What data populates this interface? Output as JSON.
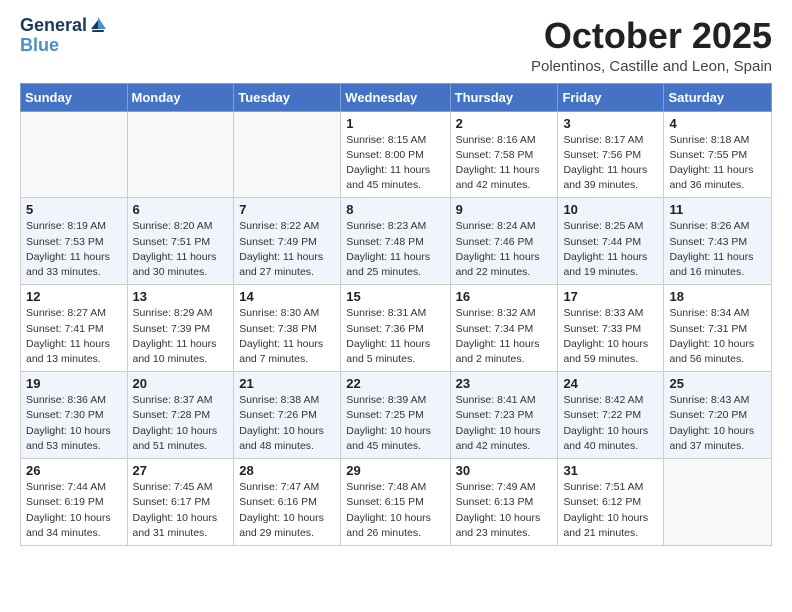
{
  "header": {
    "logo_line1": "General",
    "logo_line2": "Blue",
    "month": "October 2025",
    "location": "Polentinos, Castille and Leon, Spain"
  },
  "days_of_week": [
    "Sunday",
    "Monday",
    "Tuesday",
    "Wednesday",
    "Thursday",
    "Friday",
    "Saturday"
  ],
  "weeks": [
    [
      {
        "day": "",
        "info": ""
      },
      {
        "day": "",
        "info": ""
      },
      {
        "day": "",
        "info": ""
      },
      {
        "day": "1",
        "info": "Sunrise: 8:15 AM\nSunset: 8:00 PM\nDaylight: 11 hours and 45 minutes."
      },
      {
        "day": "2",
        "info": "Sunrise: 8:16 AM\nSunset: 7:58 PM\nDaylight: 11 hours and 42 minutes."
      },
      {
        "day": "3",
        "info": "Sunrise: 8:17 AM\nSunset: 7:56 PM\nDaylight: 11 hours and 39 minutes."
      },
      {
        "day": "4",
        "info": "Sunrise: 8:18 AM\nSunset: 7:55 PM\nDaylight: 11 hours and 36 minutes."
      }
    ],
    [
      {
        "day": "5",
        "info": "Sunrise: 8:19 AM\nSunset: 7:53 PM\nDaylight: 11 hours and 33 minutes."
      },
      {
        "day": "6",
        "info": "Sunrise: 8:20 AM\nSunset: 7:51 PM\nDaylight: 11 hours and 30 minutes."
      },
      {
        "day": "7",
        "info": "Sunrise: 8:22 AM\nSunset: 7:49 PM\nDaylight: 11 hours and 27 minutes."
      },
      {
        "day": "8",
        "info": "Sunrise: 8:23 AM\nSunset: 7:48 PM\nDaylight: 11 hours and 25 minutes."
      },
      {
        "day": "9",
        "info": "Sunrise: 8:24 AM\nSunset: 7:46 PM\nDaylight: 11 hours and 22 minutes."
      },
      {
        "day": "10",
        "info": "Sunrise: 8:25 AM\nSunset: 7:44 PM\nDaylight: 11 hours and 19 minutes."
      },
      {
        "day": "11",
        "info": "Sunrise: 8:26 AM\nSunset: 7:43 PM\nDaylight: 11 hours and 16 minutes."
      }
    ],
    [
      {
        "day": "12",
        "info": "Sunrise: 8:27 AM\nSunset: 7:41 PM\nDaylight: 11 hours and 13 minutes."
      },
      {
        "day": "13",
        "info": "Sunrise: 8:29 AM\nSunset: 7:39 PM\nDaylight: 11 hours and 10 minutes."
      },
      {
        "day": "14",
        "info": "Sunrise: 8:30 AM\nSunset: 7:38 PM\nDaylight: 11 hours and 7 minutes."
      },
      {
        "day": "15",
        "info": "Sunrise: 8:31 AM\nSunset: 7:36 PM\nDaylight: 11 hours and 5 minutes."
      },
      {
        "day": "16",
        "info": "Sunrise: 8:32 AM\nSunset: 7:34 PM\nDaylight: 11 hours and 2 minutes."
      },
      {
        "day": "17",
        "info": "Sunrise: 8:33 AM\nSunset: 7:33 PM\nDaylight: 10 hours and 59 minutes."
      },
      {
        "day": "18",
        "info": "Sunrise: 8:34 AM\nSunset: 7:31 PM\nDaylight: 10 hours and 56 minutes."
      }
    ],
    [
      {
        "day": "19",
        "info": "Sunrise: 8:36 AM\nSunset: 7:30 PM\nDaylight: 10 hours and 53 minutes."
      },
      {
        "day": "20",
        "info": "Sunrise: 8:37 AM\nSunset: 7:28 PM\nDaylight: 10 hours and 51 minutes."
      },
      {
        "day": "21",
        "info": "Sunrise: 8:38 AM\nSunset: 7:26 PM\nDaylight: 10 hours and 48 minutes."
      },
      {
        "day": "22",
        "info": "Sunrise: 8:39 AM\nSunset: 7:25 PM\nDaylight: 10 hours and 45 minutes."
      },
      {
        "day": "23",
        "info": "Sunrise: 8:41 AM\nSunset: 7:23 PM\nDaylight: 10 hours and 42 minutes."
      },
      {
        "day": "24",
        "info": "Sunrise: 8:42 AM\nSunset: 7:22 PM\nDaylight: 10 hours and 40 minutes."
      },
      {
        "day": "25",
        "info": "Sunrise: 8:43 AM\nSunset: 7:20 PM\nDaylight: 10 hours and 37 minutes."
      }
    ],
    [
      {
        "day": "26",
        "info": "Sunrise: 7:44 AM\nSunset: 6:19 PM\nDaylight: 10 hours and 34 minutes."
      },
      {
        "day": "27",
        "info": "Sunrise: 7:45 AM\nSunset: 6:17 PM\nDaylight: 10 hours and 31 minutes."
      },
      {
        "day": "28",
        "info": "Sunrise: 7:47 AM\nSunset: 6:16 PM\nDaylight: 10 hours and 29 minutes."
      },
      {
        "day": "29",
        "info": "Sunrise: 7:48 AM\nSunset: 6:15 PM\nDaylight: 10 hours and 26 minutes."
      },
      {
        "day": "30",
        "info": "Sunrise: 7:49 AM\nSunset: 6:13 PM\nDaylight: 10 hours and 23 minutes."
      },
      {
        "day": "31",
        "info": "Sunrise: 7:51 AM\nSunset: 6:12 PM\nDaylight: 10 hours and 21 minutes."
      },
      {
        "day": "",
        "info": ""
      }
    ]
  ]
}
